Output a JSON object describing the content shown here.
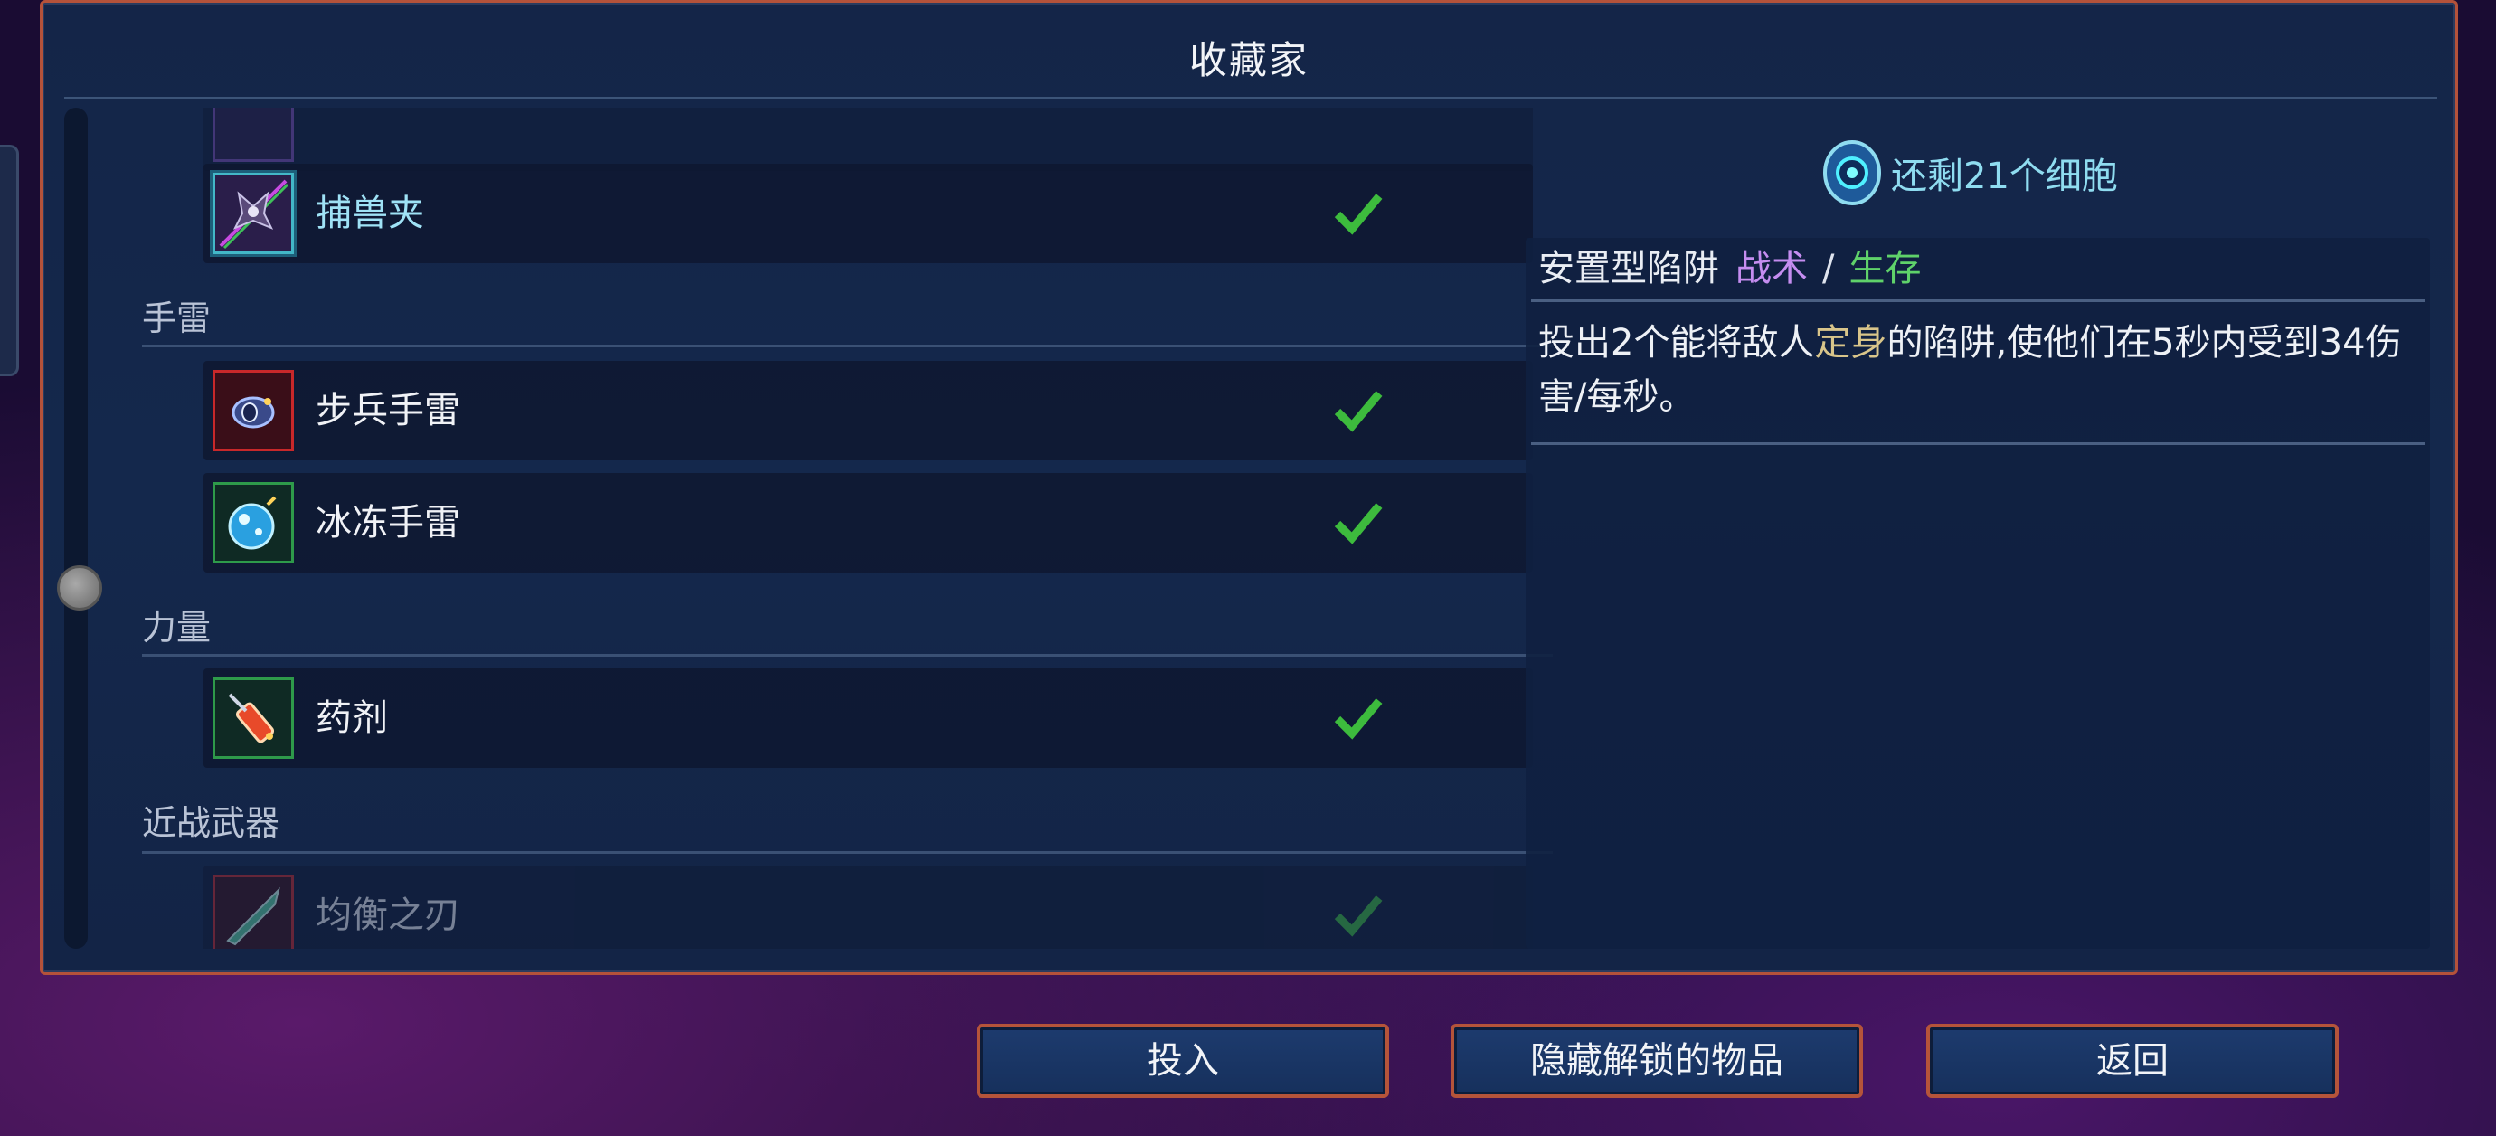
{
  "window": {
    "title": "收藏家"
  },
  "list": {
    "rows": [
      {
        "label": "捕兽夹",
        "selected": true,
        "icon": "bear-trap-icon",
        "checked": true
      },
      {
        "category": "手雷"
      },
      {
        "label": "步兵手雷",
        "icon": "infantry-grenade-icon",
        "checked": true
      },
      {
        "label": "冰冻手雷",
        "icon": "ice-grenade-icon",
        "checked": true
      },
      {
        "category": "力量"
      },
      {
        "label": "药剂",
        "icon": "potion-icon",
        "checked": true
      },
      {
        "category": "近战武器"
      },
      {
        "label": "均衡之刃",
        "icon": "balanced-blade-icon",
        "checked": true,
        "partially_visible": true
      }
    ],
    "categories": {
      "grenades": "手雷",
      "power": "力量",
      "melee": "近战武器"
    },
    "items": {
      "bear_trap": "捕兽夹",
      "infantry_grenade": "步兵手雷",
      "ice_grenade": "冰冻手雷",
      "potion": "药剂",
      "balanced_blade": "均衡之刃"
    }
  },
  "detail": {
    "cells_remaining": "还剩21个细胞",
    "type": "安置型陷阱",
    "tag_tactics": "战术",
    "separator": "/",
    "tag_survival": "生存",
    "description_part1": "投出2个能将敌人",
    "description_highlight": "定身",
    "description_part2": "的陷阱,使他们在5秒内受到34伤害/每秒。"
  },
  "buttons": {
    "invest": "投入",
    "hide_unlocked": "隐藏解锁的物品",
    "back": "返回"
  },
  "colors": {
    "panel_border": "#b4523a",
    "panel_bg": "#142548",
    "check_green": "#3dbb3d",
    "tactics_purple": "#c58df0",
    "survival_green": "#5fd26a",
    "highlight_gold": "#d9c58a",
    "cells_cyan": "#8fdcf0"
  }
}
